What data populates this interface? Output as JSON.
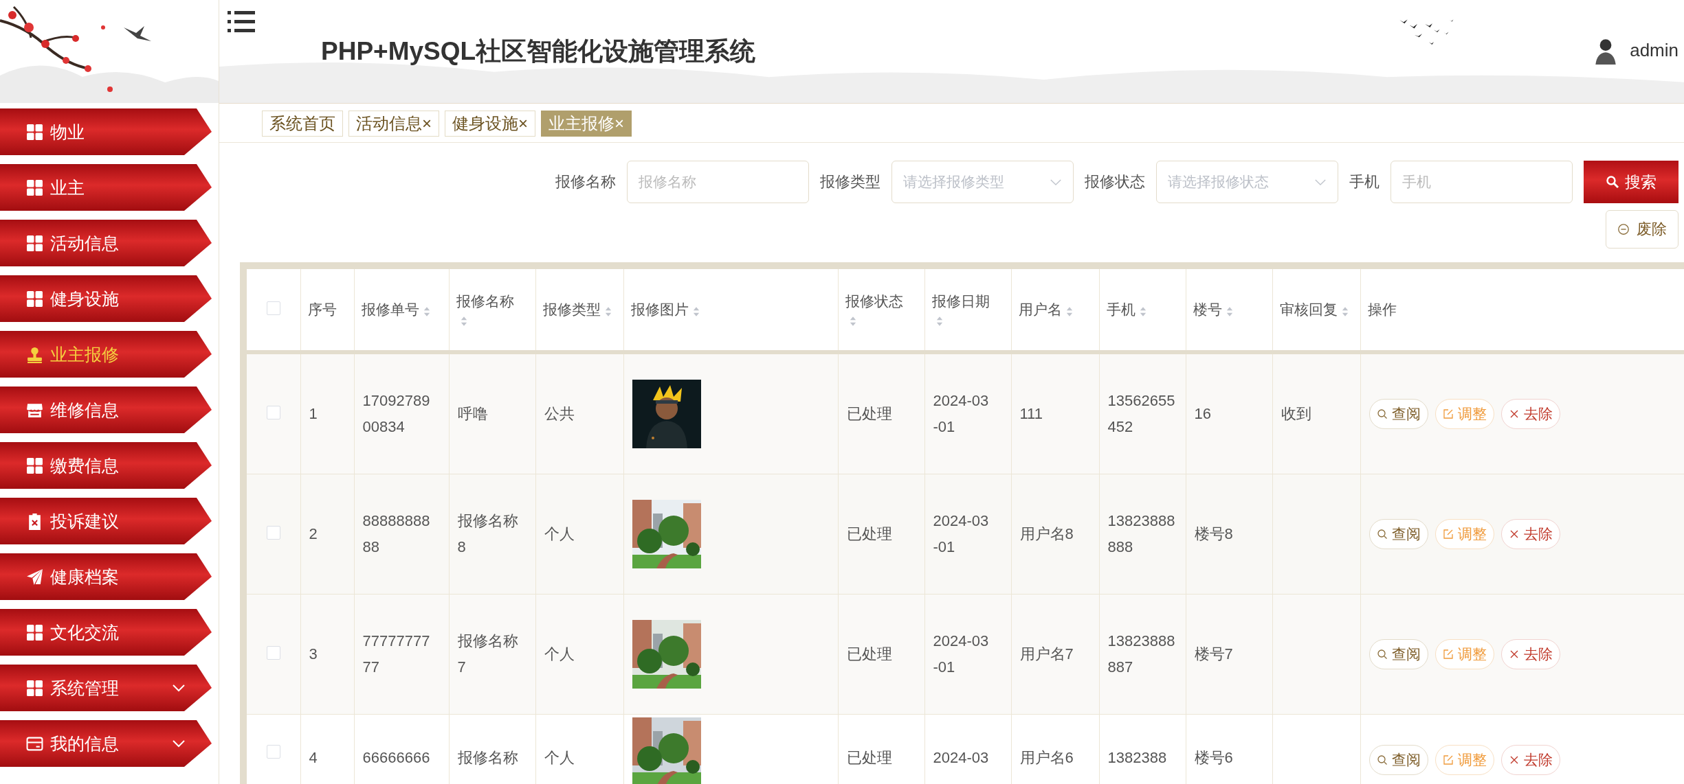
{
  "header": {
    "title": "PHP+MySQL社区智能化设施管理系统",
    "user": "admin"
  },
  "sidebar": {
    "items": [
      {
        "label": "物业",
        "kind": "grid",
        "selected": false,
        "submenu": false
      },
      {
        "label": "业主",
        "kind": "grid",
        "selected": false,
        "submenu": false
      },
      {
        "label": "活动信息",
        "kind": "grid",
        "selected": false,
        "submenu": false
      },
      {
        "label": "健身设施",
        "kind": "grid",
        "selected": false,
        "submenu": false
      },
      {
        "label": "业主报修",
        "kind": "stamp",
        "selected": true,
        "submenu": false
      },
      {
        "label": "维修信息",
        "kind": "shop",
        "selected": false,
        "submenu": false
      },
      {
        "label": "缴费信息",
        "kind": "grid",
        "selected": false,
        "submenu": false
      },
      {
        "label": "投诉建议",
        "kind": "clipboard",
        "selected": false,
        "submenu": false
      },
      {
        "label": "健康档案",
        "kind": "plane",
        "selected": false,
        "submenu": false
      },
      {
        "label": "文化交流",
        "kind": "grid",
        "selected": false,
        "submenu": false
      },
      {
        "label": "系统管理",
        "kind": "grid",
        "selected": false,
        "submenu": true
      },
      {
        "label": "我的信息",
        "kind": "card",
        "selected": false,
        "submenu": true
      }
    ]
  },
  "tabs": [
    {
      "label": "系统首页",
      "selected": false
    },
    {
      "label": "活动信息",
      "close": "×",
      "selected": false
    },
    {
      "label": "健身设施",
      "close": "×",
      "selected": false
    },
    {
      "label": "业主报修",
      "close": "×",
      "selected": true
    }
  ],
  "search": {
    "fields": [
      {
        "label": "报修名称",
        "kind": "input",
        "placeholder": "报修名称"
      },
      {
        "label": "报修类型",
        "kind": "select",
        "placeholder": "请选择报修类型"
      },
      {
        "label": "报修状态",
        "kind": "select",
        "placeholder": "请选择报修状态"
      },
      {
        "label": "手机",
        "kind": "input",
        "placeholder": "手机"
      }
    ],
    "search_button": "搜索",
    "delete_button": "废除"
  },
  "table": {
    "select_all": {
      "checked": false
    },
    "columns": [
      {
        "label": "序号",
        "sortable": false
      },
      {
        "label": "报修单号",
        "sortable": true
      },
      {
        "label": "报修名称",
        "sortable": true
      },
      {
        "label": "报修类型",
        "sortable": true
      },
      {
        "label": "报修图片",
        "sortable": true
      },
      {
        "label": "报修状态",
        "sortable": true
      },
      {
        "label": "报修日期",
        "sortable": true
      },
      {
        "label": "用户名",
        "sortable": true
      },
      {
        "label": "手机",
        "sortable": true
      },
      {
        "label": "楼号",
        "sortable": true
      },
      {
        "label": "审核回复",
        "sortable": true
      },
      {
        "label": "操作",
        "sortable": false
      }
    ],
    "rows": [
      {
        "checked": false,
        "seq": "1",
        "order_no": "1709278900834",
        "name": "呼噜",
        "type": "公共",
        "photo": {
          "kind": "picture"
        },
        "status": "已处理",
        "date": "2024-03-01",
        "user": "111",
        "phone": "13562655452",
        "building": "16",
        "reply": "收到",
        "actions": [
          {
            "kind": "view",
            "label": "查阅"
          },
          {
            "kind": "edit",
            "label": "调整"
          },
          {
            "kind": "delete",
            "label": "去除"
          }
        ]
      },
      {
        "checked": false,
        "seq": "2",
        "order_no": "8888888888",
        "name": "报修名称8",
        "type": "个人",
        "photo": {
          "kind": "picture"
        },
        "status": "已处理",
        "date": "2024-03-01",
        "user": "用户名8",
        "phone": "13823888888",
        "building": "楼号8",
        "actions": [
          {
            "kind": "view",
            "label": "查阅"
          },
          {
            "kind": "edit",
            "label": "调整"
          },
          {
            "kind": "delete",
            "label": "去除"
          }
        ]
      },
      {
        "checked": false,
        "seq": "3",
        "order_no": "7777777777",
        "name": "报修名称7",
        "type": "个人",
        "photo": {
          "kind": "picture"
        },
        "status": "已处理",
        "date": "2024-03-01",
        "user": "用户名7",
        "phone": "13823888887",
        "building": "楼号7",
        "actions": [
          {
            "kind": "view",
            "label": "查阅"
          },
          {
            "kind": "edit",
            "label": "调整"
          },
          {
            "kind": "delete",
            "label": "去除"
          }
        ]
      },
      {
        "checked": false,
        "seq": "4",
        "order_no": "66666666",
        "name": "报修名称",
        "type": "个人",
        "photo": {
          "kind": "picture"
        },
        "status": "已处理",
        "date": "2024-03",
        "user": "用户名6",
        "phone": "1382388",
        "building": "楼号6",
        "actions": [
          {
            "kind": "view",
            "label": "查阅"
          },
          {
            "kind": "edit",
            "label": "调整"
          },
          {
            "kind": "delete",
            "label": "去除"
          }
        ]
      }
    ]
  }
}
